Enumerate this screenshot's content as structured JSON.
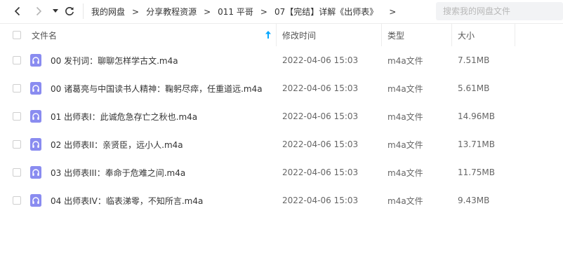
{
  "nav": {
    "back_icon": "chevron-left-icon",
    "forward_icon": "chevron-right-icon",
    "history_icon": "caret-down-icon",
    "refresh_icon": "refresh-icon"
  },
  "breadcrumb": [
    {
      "label": "我的网盘"
    },
    {
      "label": "分享教程资源"
    },
    {
      "label": "011 平哥"
    },
    {
      "label": "07【完结】详解《出师表》"
    }
  ],
  "search": {
    "placeholder": "搜索我的网盘文件"
  },
  "columns": {
    "name": "文件名",
    "modified": "修改时间",
    "type": "类型",
    "size": "大小"
  },
  "sort": {
    "column": "name",
    "direction": "ascending",
    "icon": "arrow-up-icon"
  },
  "files": [
    {
      "name": "00 发刊词：聊聊怎样学古文.m4a",
      "modified": "2022-04-06 15:03",
      "type": "m4a文件",
      "size": "7.51MB",
      "icon": "audio-file-icon"
    },
    {
      "name": "00 诸葛亮与中国读书人精神：鞠躬尽瘁，任重道远.m4a",
      "modified": "2022-04-06 15:03",
      "type": "m4a文件",
      "size": "5.61MB",
      "icon": "audio-file-icon"
    },
    {
      "name": "01 出师表I：此诚危急存亡之秋也.m4a",
      "modified": "2022-04-06 15:03",
      "type": "m4a文件",
      "size": "14.96MB",
      "icon": "audio-file-icon"
    },
    {
      "name": "02 出师表II：亲贤臣，远小人.m4a",
      "modified": "2022-04-06 15:03",
      "type": "m4a文件",
      "size": "13.71MB",
      "icon": "audio-file-icon"
    },
    {
      "name": "03 出师表III：奉命于危难之间.m4a",
      "modified": "2022-04-06 15:03",
      "type": "m4a文件",
      "size": "11.75MB",
      "icon": "audio-file-icon"
    },
    {
      "name": "04 出师表IV：临表涕零，不知所言.m4a",
      "modified": "2022-04-06 15:03",
      "type": "m4a文件",
      "size": "9.43MB",
      "icon": "audio-file-icon"
    }
  ],
  "colors": {
    "accent": "#06a7ff",
    "file_icon": "#8a8cf0"
  }
}
